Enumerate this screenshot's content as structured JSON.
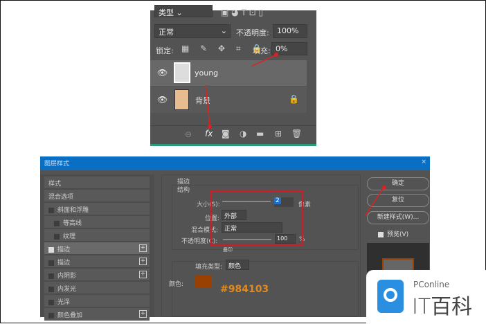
{
  "layers_panel": {
    "filter": "类型",
    "blend_mode": "正常",
    "opacity_label": "不透明度:",
    "opacity": "100%",
    "lock_label": "锁定:",
    "fill_label": "填充:",
    "fill": "0%",
    "layers": [
      {
        "name": "young",
        "selected": true
      },
      {
        "name": "背景",
        "locked": true
      }
    ]
  },
  "dialog": {
    "title": "图层样式",
    "styles": [
      {
        "label": "样式",
        "checkbox": false
      },
      {
        "label": "混合选项",
        "checkbox": false
      },
      {
        "label": "斜面和浮雕",
        "checkbox": true,
        "checked": false
      },
      {
        "label": "等高线",
        "checkbox": true,
        "checked": false,
        "indent": true
      },
      {
        "label": "纹理",
        "checkbox": true,
        "checked": false,
        "indent": true
      },
      {
        "label": "描边",
        "checkbox": true,
        "checked": true,
        "plus": true,
        "active": true
      },
      {
        "label": "描边",
        "checkbox": true,
        "checked": false,
        "plus": true
      },
      {
        "label": "内阴影",
        "checkbox": true,
        "checked": false,
        "plus": true
      },
      {
        "label": "内发光",
        "checkbox": true,
        "checked": false
      },
      {
        "label": "光泽",
        "checkbox": true,
        "checked": false
      },
      {
        "label": "颜色叠加",
        "checkbox": true,
        "checked": false,
        "plus": true
      }
    ],
    "section": "描边",
    "group": "结构",
    "size_label": "大小(S):",
    "size": "2",
    "size_unit": "像素",
    "position_label": "位置:",
    "position": "外部",
    "blend_label": "混合模式:",
    "blend": "正常",
    "opacity_label": "不透明度(C):",
    "opacity": "100",
    "opacity_unit": "%",
    "overprint": "叠印",
    "fill_type_label": "填充类型:",
    "fill_type": "颜色",
    "color_label": "颜色:",
    "color": "#984103",
    "color_annotation": "#984103",
    "ok": "确定",
    "reset": "复位",
    "new_style": "新建样式(W)...",
    "preview": "预览(V)"
  },
  "watermark": {
    "brand": "PConline",
    "name": "IT百科",
    "accent": "#2a8fe0"
  }
}
